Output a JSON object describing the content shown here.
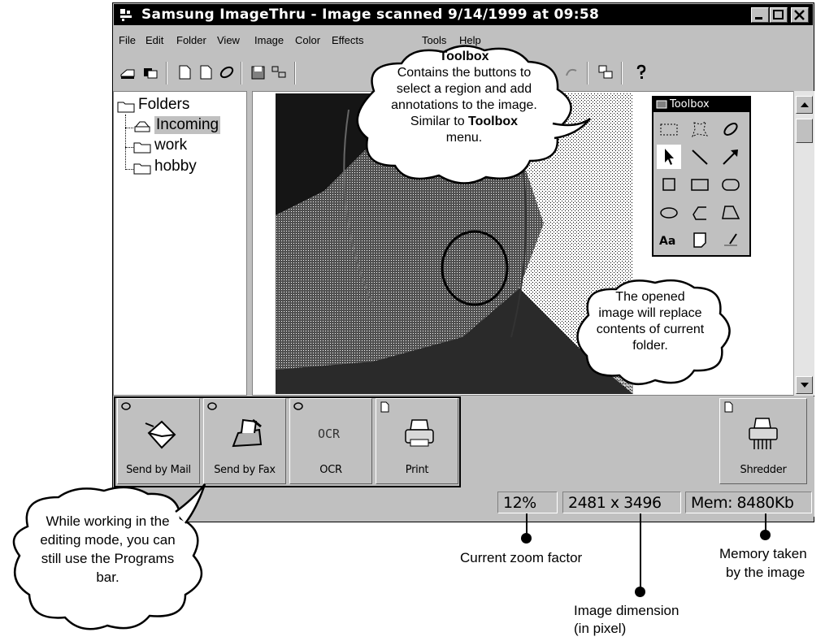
{
  "window": {
    "title": "Samsung ImageThru - Image scanned 9/14/1999 at 09:58",
    "controls": [
      "minimize",
      "maximize",
      "close"
    ]
  },
  "menu": [
    {
      "label": "File",
      "icon": ""
    },
    {
      "label": "Edit",
      "icon": ""
    },
    {
      "label": "Folder",
      "icon": ""
    },
    {
      "label": "View",
      "icon": ""
    },
    {
      "label": "Image",
      "icon": ""
    },
    {
      "label": "Color",
      "icon": ""
    },
    {
      "label": "Effects",
      "icon": ""
    },
    {
      "label": "Toolbox",
      "icon": ""
    },
    {
      "label": "Tools",
      "icon": ""
    },
    {
      "label": "Help",
      "icon": ""
    }
  ],
  "toolbar_icons": [
    "scan-icon",
    "copy-folder-icon",
    "new-page-icon",
    "blank-page-icon",
    "attach-icon",
    "save-icon",
    "thumbnail-icon",
    "cut-icon",
    "undo-icon",
    "redo-icon",
    "properties-icon",
    "help-icon"
  ],
  "folders": {
    "root": "Folders",
    "items": [
      "Incoming",
      "work",
      "hobby"
    ],
    "selected": "Incoming"
  },
  "toolbox": {
    "title": "Toolbox",
    "tools": [
      "rect-select-icon",
      "lasso-select-icon",
      "freehand-select-icon",
      "pointer-icon",
      "line-icon",
      "arrow-icon",
      "square-icon",
      "rectangle-icon",
      "rounded-rect-icon",
      "ellipse-icon",
      "polyline-icon",
      "polygon-icon",
      "text-icon",
      "note-icon",
      "highlighter-icon"
    ]
  },
  "programs": [
    {
      "label": "Send by Mail",
      "icon": "mail-icon"
    },
    {
      "label": "Send by Fax",
      "icon": "fax-icon"
    },
    {
      "label": "OCR",
      "icon": "ocr-icon"
    },
    {
      "label": "Print",
      "icon": "printer-icon"
    }
  ],
  "shredder": {
    "label": "Shredder",
    "icon": "shredder-icon"
  },
  "status": {
    "zoom": "12%",
    "dimension": "2481 x 3496",
    "memory": "Mem: 8480Kb"
  },
  "callouts": {
    "toolbox": {
      "title": "Toolbox",
      "line1": "Contains the buttons to",
      "line2": "select a region and add",
      "line3": "annotations to the image.",
      "line4_pre": "Similar to ",
      "line4_bold": "Toolbox",
      "line5": "menu."
    },
    "folder": {
      "line1": "The opened",
      "line2": "image will replace",
      "line3": "contents of current",
      "line4": "folder."
    },
    "programs": {
      "line1": "While working in the",
      "line2": "editing mode, you can",
      "line3": "still use the Programs",
      "line4": "bar."
    }
  },
  "annotations": {
    "zoom": "Current zoom factor",
    "dimension_1": "Image dimension",
    "dimension_2": "(in pixel)",
    "memory_1": "Memory taken",
    "memory_2": "by the image"
  }
}
